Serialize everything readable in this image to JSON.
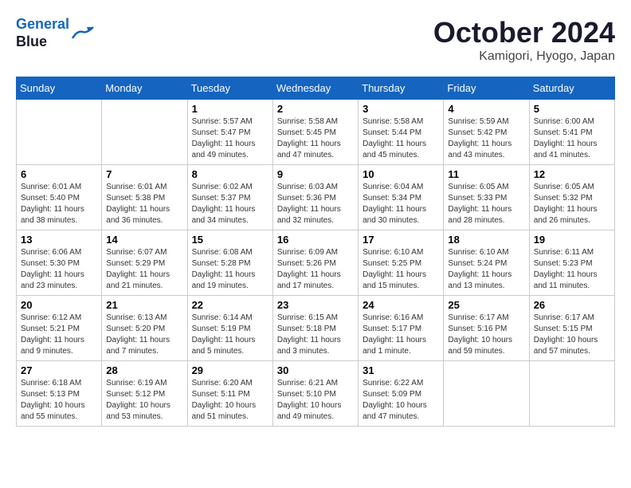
{
  "logo": {
    "line1": "General",
    "line2": "Blue"
  },
  "title": "October 2024",
  "subtitle": "Kamigori, Hyogo, Japan",
  "weekdays": [
    "Sunday",
    "Monday",
    "Tuesday",
    "Wednesday",
    "Thursday",
    "Friday",
    "Saturday"
  ],
  "weeks": [
    [
      {
        "day": "",
        "info": ""
      },
      {
        "day": "",
        "info": ""
      },
      {
        "day": "1",
        "info": "Sunrise: 5:57 AM\nSunset: 5:47 PM\nDaylight: 11 hours and 49 minutes."
      },
      {
        "day": "2",
        "info": "Sunrise: 5:58 AM\nSunset: 5:45 PM\nDaylight: 11 hours and 47 minutes."
      },
      {
        "day": "3",
        "info": "Sunrise: 5:58 AM\nSunset: 5:44 PM\nDaylight: 11 hours and 45 minutes."
      },
      {
        "day": "4",
        "info": "Sunrise: 5:59 AM\nSunset: 5:42 PM\nDaylight: 11 hours and 43 minutes."
      },
      {
        "day": "5",
        "info": "Sunrise: 6:00 AM\nSunset: 5:41 PM\nDaylight: 11 hours and 41 minutes."
      }
    ],
    [
      {
        "day": "6",
        "info": "Sunrise: 6:01 AM\nSunset: 5:40 PM\nDaylight: 11 hours and 38 minutes."
      },
      {
        "day": "7",
        "info": "Sunrise: 6:01 AM\nSunset: 5:38 PM\nDaylight: 11 hours and 36 minutes."
      },
      {
        "day": "8",
        "info": "Sunrise: 6:02 AM\nSunset: 5:37 PM\nDaylight: 11 hours and 34 minutes."
      },
      {
        "day": "9",
        "info": "Sunrise: 6:03 AM\nSunset: 5:36 PM\nDaylight: 11 hours and 32 minutes."
      },
      {
        "day": "10",
        "info": "Sunrise: 6:04 AM\nSunset: 5:34 PM\nDaylight: 11 hours and 30 minutes."
      },
      {
        "day": "11",
        "info": "Sunrise: 6:05 AM\nSunset: 5:33 PM\nDaylight: 11 hours and 28 minutes."
      },
      {
        "day": "12",
        "info": "Sunrise: 6:05 AM\nSunset: 5:32 PM\nDaylight: 11 hours and 26 minutes."
      }
    ],
    [
      {
        "day": "13",
        "info": "Sunrise: 6:06 AM\nSunset: 5:30 PM\nDaylight: 11 hours and 23 minutes."
      },
      {
        "day": "14",
        "info": "Sunrise: 6:07 AM\nSunset: 5:29 PM\nDaylight: 11 hours and 21 minutes."
      },
      {
        "day": "15",
        "info": "Sunrise: 6:08 AM\nSunset: 5:28 PM\nDaylight: 11 hours and 19 minutes."
      },
      {
        "day": "16",
        "info": "Sunrise: 6:09 AM\nSunset: 5:26 PM\nDaylight: 11 hours and 17 minutes."
      },
      {
        "day": "17",
        "info": "Sunrise: 6:10 AM\nSunset: 5:25 PM\nDaylight: 11 hours and 15 minutes."
      },
      {
        "day": "18",
        "info": "Sunrise: 6:10 AM\nSunset: 5:24 PM\nDaylight: 11 hours and 13 minutes."
      },
      {
        "day": "19",
        "info": "Sunrise: 6:11 AM\nSunset: 5:23 PM\nDaylight: 11 hours and 11 minutes."
      }
    ],
    [
      {
        "day": "20",
        "info": "Sunrise: 6:12 AM\nSunset: 5:21 PM\nDaylight: 11 hours and 9 minutes."
      },
      {
        "day": "21",
        "info": "Sunrise: 6:13 AM\nSunset: 5:20 PM\nDaylight: 11 hours and 7 minutes."
      },
      {
        "day": "22",
        "info": "Sunrise: 6:14 AM\nSunset: 5:19 PM\nDaylight: 11 hours and 5 minutes."
      },
      {
        "day": "23",
        "info": "Sunrise: 6:15 AM\nSunset: 5:18 PM\nDaylight: 11 hours and 3 minutes."
      },
      {
        "day": "24",
        "info": "Sunrise: 6:16 AM\nSunset: 5:17 PM\nDaylight: 11 hours and 1 minute."
      },
      {
        "day": "25",
        "info": "Sunrise: 6:17 AM\nSunset: 5:16 PM\nDaylight: 10 hours and 59 minutes."
      },
      {
        "day": "26",
        "info": "Sunrise: 6:17 AM\nSunset: 5:15 PM\nDaylight: 10 hours and 57 minutes."
      }
    ],
    [
      {
        "day": "27",
        "info": "Sunrise: 6:18 AM\nSunset: 5:13 PM\nDaylight: 10 hours and 55 minutes."
      },
      {
        "day": "28",
        "info": "Sunrise: 6:19 AM\nSunset: 5:12 PM\nDaylight: 10 hours and 53 minutes."
      },
      {
        "day": "29",
        "info": "Sunrise: 6:20 AM\nSunset: 5:11 PM\nDaylight: 10 hours and 51 minutes."
      },
      {
        "day": "30",
        "info": "Sunrise: 6:21 AM\nSunset: 5:10 PM\nDaylight: 10 hours and 49 minutes."
      },
      {
        "day": "31",
        "info": "Sunrise: 6:22 AM\nSunset: 5:09 PM\nDaylight: 10 hours and 47 minutes."
      },
      {
        "day": "",
        "info": ""
      },
      {
        "day": "",
        "info": ""
      }
    ]
  ]
}
